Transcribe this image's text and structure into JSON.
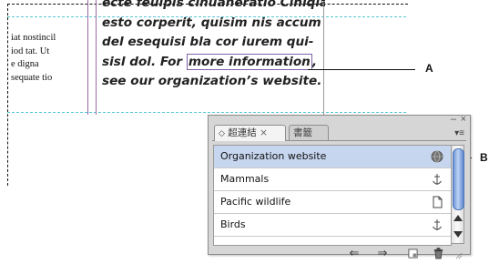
{
  "document": {
    "left_column_lines": [
      "iat nostincil",
      "iod tat. Ut",
      "e digna",
      "sequate tio"
    ],
    "body_lines": [
      "ecte feuipis cinuaneratio Ciniqia",
      "esto corperit, quisim nis accum",
      "del esequisi bla cor iurem qui-",
      "sisl dol. For ",
      "see our organization’s website."
    ],
    "hyperlink_text": "more information",
    "hyperlink_suffix": ","
  },
  "callouts": {
    "a": "A",
    "b": "B"
  },
  "panel": {
    "tabs": [
      {
        "label": "超連結",
        "icon": "diamond-arrows-icon",
        "close": "×",
        "active": true
      },
      {
        "label": "書籤",
        "active": false
      }
    ],
    "window_buttons": {
      "minimize": "‒",
      "close": "×"
    },
    "items": [
      {
        "label": "Organization website",
        "icon": "globe-url-icon",
        "selected": true
      },
      {
        "label": "Mammals",
        "icon": "anchor-icon",
        "selected": false
      },
      {
        "label": "Pacific wildlife",
        "icon": "page-icon",
        "selected": false
      },
      {
        "label": "Birds",
        "icon": "anchor-icon",
        "selected": false
      }
    ],
    "toolbar": [
      "go-to-source-icon",
      "go-to-destination-icon",
      "new-hyperlink-icon",
      "delete-icon"
    ],
    "colors": {
      "selected_row": "#c7d6ef",
      "hyperlink_border": "#7f5fa6",
      "guide": "#59c6d8",
      "scroll_thumb": "#6e95d6"
    }
  }
}
